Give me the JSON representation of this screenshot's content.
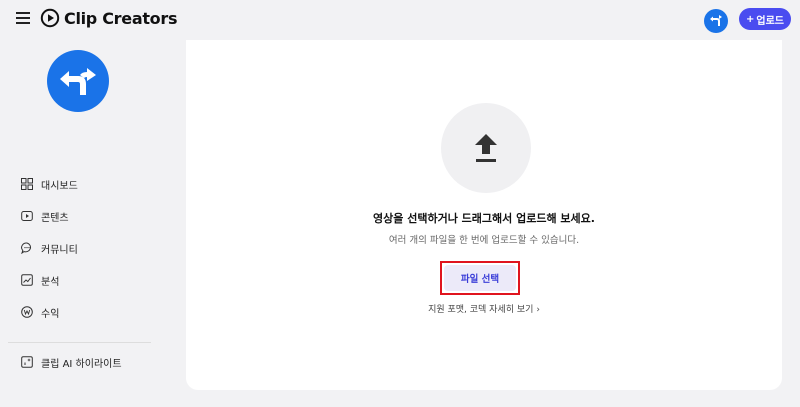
{
  "header": {
    "brand": "Clip Creators",
    "upload_label": "업로드",
    "upload_plus": "+"
  },
  "sidebar": {
    "items": [
      {
        "label": "대시보드",
        "icon": "dashboard-icon"
      },
      {
        "label": "콘텐츠",
        "icon": "content-icon"
      },
      {
        "label": "커뮤니티",
        "icon": "community-icon"
      },
      {
        "label": "분석",
        "icon": "analytics-icon"
      },
      {
        "label": "수익",
        "icon": "revenue-icon"
      }
    ],
    "highlight": {
      "label": "클립 AI 하이라이트",
      "icon": "highlight-icon"
    }
  },
  "main": {
    "title": "영상을 선택하거나 드래그해서 업로드해 보세요.",
    "subtitle": "여러 개의 파일을 한 번에 업로드할 수 있습니다.",
    "select_button": "파일 선택",
    "codec_link": "지원 포맷, 코덱 자세히 보기",
    "codec_chevron": "›"
  },
  "colors": {
    "accent": "#4a4cf0",
    "brand_blue": "#1a73e8",
    "highlight_outline": "#e0141e"
  }
}
